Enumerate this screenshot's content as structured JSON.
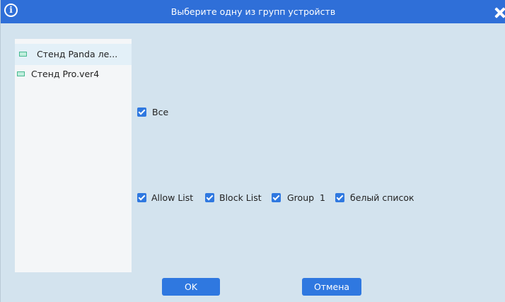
{
  "dialog": {
    "title": "Выберите одну из групп устройств",
    "info_icon_glyph": "i",
    "close_icon": "close-icon"
  },
  "groups": [
    {
      "label": "Стенд Panda ле...",
      "selected": true,
      "icon": "device-icon"
    },
    {
      "label": "Стенд Pro.ver4",
      "selected": false,
      "icon": "device-icon"
    }
  ],
  "options": {
    "all": {
      "label": "Все",
      "checked": true
    },
    "lists": [
      {
        "label": "Allow List",
        "checked": true
      },
      {
        "label": "Block List",
        "checked": true
      },
      {
        "label": "Group  1",
        "checked": true
      },
      {
        "label": "белый список",
        "checked": true
      }
    ]
  },
  "buttons": {
    "ok": "OK",
    "cancel": "Отмена"
  },
  "colors": {
    "titlebar": "#2f6fd8",
    "background": "#d3e3ee",
    "accent": "#2f78e0"
  }
}
